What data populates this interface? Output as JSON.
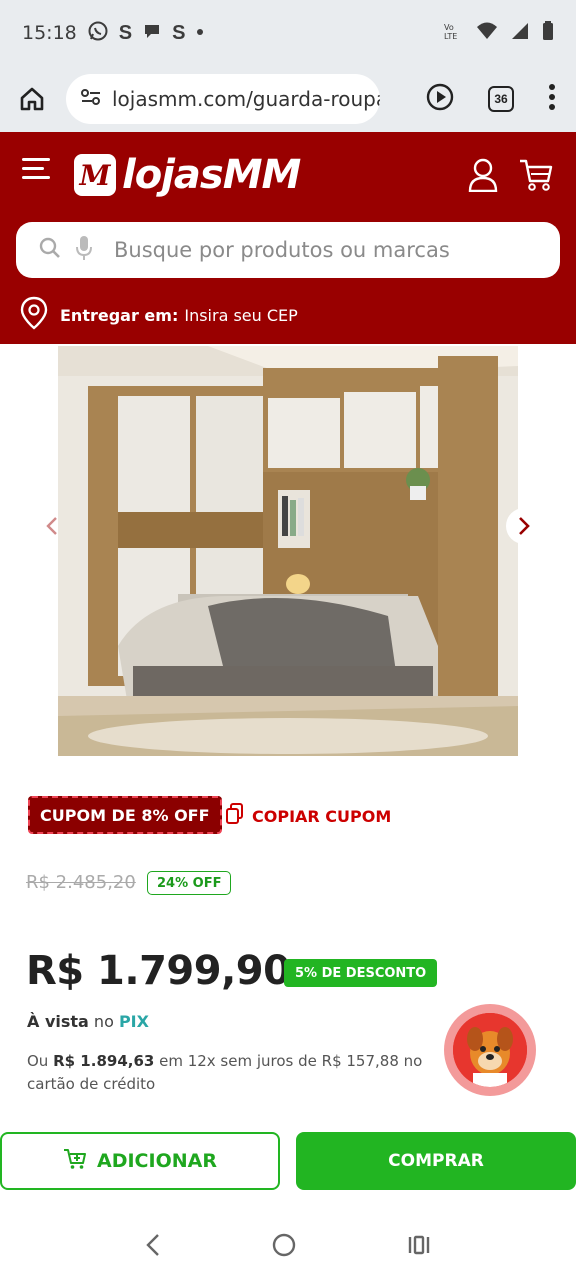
{
  "status_bar": {
    "time": "15:18",
    "notification_icons": [
      "whatsapp-icon",
      "s-app-icon",
      "chat-icon",
      "s-app-icon",
      "dot-icon"
    ],
    "right_icons": [
      "volte-icon",
      "wifi-icon",
      "signal-icon",
      "battery-icon"
    ]
  },
  "browser": {
    "url": "lojasmm.com/guarda-roupa",
    "tab_count": "36"
  },
  "header": {
    "logo_mark": "M",
    "logo_text": "lojasMM",
    "search_placeholder": "Busque por produtos ou marcas",
    "deliver_label": "Entregar em:",
    "deliver_value": "Insira seu CEP",
    "brand_color": "#990000"
  },
  "product": {
    "coupon_badge": "CUPOM DE 8% OFF",
    "copy_coupon": "COPIAR CUPOM",
    "old_price": "R$ 2.485,20",
    "off_badge": "24% OFF",
    "price": "R$ 1.799,90",
    "discount_badge": "5% DE DESCONTO",
    "pix_bold": "À vista",
    "pix_mid": " no ",
    "pix_method": "PIX",
    "inst_prefix": "Ou ",
    "inst_total": "R$ 1.894,63",
    "inst_rest": " em 12x sem juros de R$ 157,88 no cartão de crédito"
  },
  "actions": {
    "add_label": "ADICIONAR",
    "buy_label": "COMPRAR",
    "accent_color": "#22b522"
  }
}
